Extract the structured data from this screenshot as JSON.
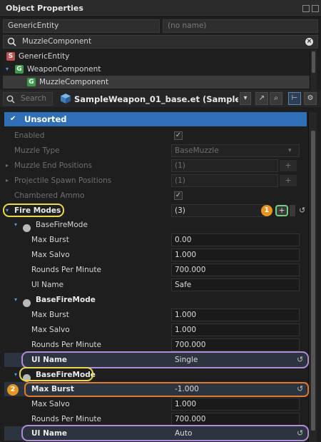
{
  "window": {
    "title": "Object Properties"
  },
  "entity": {
    "name": "GenericEntity",
    "name_placeholder": "(no name)"
  },
  "component_search": {
    "value": "MuzzleComponent"
  },
  "tree": [
    {
      "label": "GenericEntity",
      "icon": "S"
    },
    {
      "label": "WeaponComponent",
      "icon": "G"
    },
    {
      "label": "MuzzleComponent",
      "icon": "G"
    }
  ],
  "toolbar": {
    "search_placeholder": "Search",
    "prefab_name": "SampleWeapon_01_base.et (SampleMod"
  },
  "section": {
    "title": "Unsorted"
  },
  "props": {
    "enabled": {
      "label": "Enabled",
      "check": "✓"
    },
    "muzzle_type": {
      "label": "Muzzle Type",
      "value": "BaseMuzzle"
    },
    "muzzle_end": {
      "label": "Muzzle End Positions",
      "value": "(1)"
    },
    "projectile_spawn": {
      "label": "Projectile Spawn Positions",
      "value": "(1)"
    },
    "chambered": {
      "label": "Chambered Ammo",
      "check": "✓"
    },
    "fire_modes": {
      "label": "Fire Modes",
      "value": "(3)"
    }
  },
  "fire_modes": [
    {
      "label": "BaseFireMode",
      "max_burst_label": "Max Burst",
      "max_burst": "0.00",
      "max_salvo_label": "Max Salvo",
      "max_salvo": "1.000",
      "rpm_label": "Rounds Per Minute",
      "rpm": "700.000",
      "ui_name_label": "UI Name",
      "ui_name": "Safe"
    },
    {
      "label": "BaseFireMode",
      "max_burst_label": "Max Burst",
      "max_burst": "1.000",
      "max_salvo_label": "Max Salvo",
      "max_salvo": "1.000",
      "rpm_label": "Rounds Per Minute",
      "rpm": "700.000",
      "ui_name_label": "UI Name",
      "ui_name": "Single"
    },
    {
      "label": "BaseFireMode",
      "max_burst_label": "Max Burst",
      "max_burst": "-1.000",
      "max_salvo_label": "Max Salvo",
      "max_salvo": "1.000",
      "rpm_label": "Rounds Per Minute",
      "rpm": "700.000",
      "ui_name_label": "UI Name",
      "ui_name": "Auto"
    }
  ],
  "annotations": {
    "badge1": "1",
    "badge2": "2"
  },
  "glyphs": {
    "undo": "↺",
    "add": "+",
    "arrow_down": "▾",
    "arrow_right": "▸",
    "plus": "+",
    "check": "✓"
  },
  "colors": {
    "accent": "#2f6fb8",
    "yellow": "#e8d84a",
    "purple": "#b58ad6",
    "orange": "#e07b2e"
  }
}
